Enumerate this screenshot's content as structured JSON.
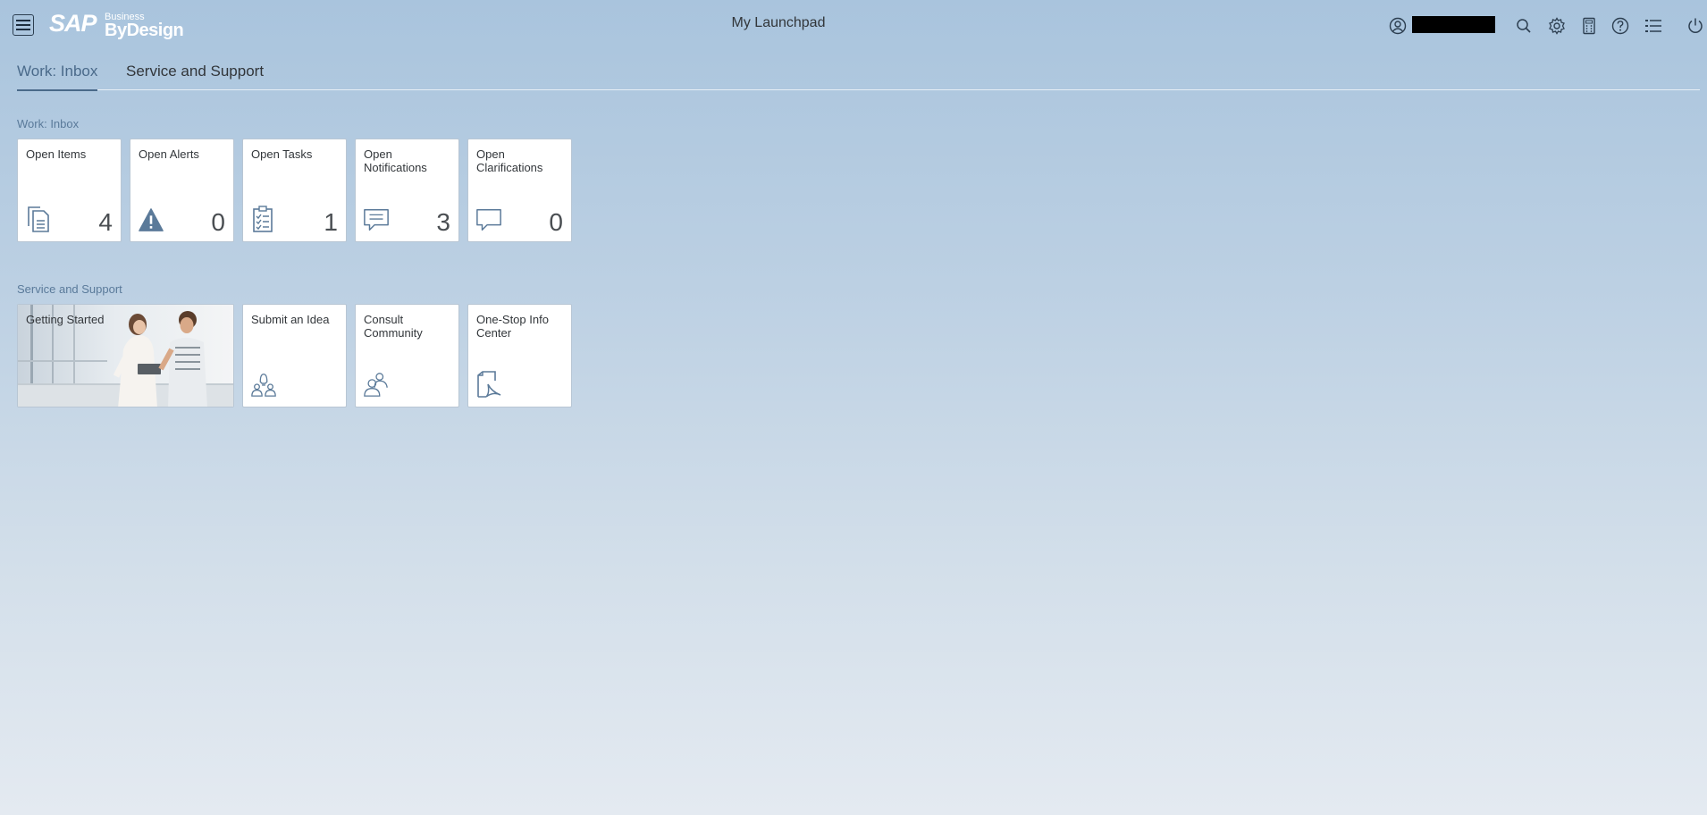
{
  "header": {
    "app_title": "My Launchpad",
    "logo": {
      "sap": "SAP",
      "business": "Business",
      "bydesign": "ByDesign"
    },
    "icons": [
      "menu-icon",
      "user-icon",
      "search-icon",
      "gear-icon",
      "calculator-icon",
      "help-icon",
      "list-icon",
      "power-icon"
    ]
  },
  "tabs": [
    {
      "label": "Work: Inbox",
      "active": true
    },
    {
      "label": "Service and Support",
      "active": false
    }
  ],
  "groups": {
    "work_inbox": {
      "title": "Work: Inbox",
      "tiles": [
        {
          "title": "Open Items",
          "count": "4",
          "icon": "documents-icon"
        },
        {
          "title": "Open Alerts",
          "count": "0",
          "icon": "alert-icon"
        },
        {
          "title": "Open Tasks",
          "count": "1",
          "icon": "task-list-icon"
        },
        {
          "title": "Open Notifications",
          "count": "3",
          "icon": "message-icon"
        },
        {
          "title": "Open Clarifications",
          "count": "0",
          "icon": "comment-icon"
        }
      ]
    },
    "service_support": {
      "title": "Service and Support",
      "tiles": [
        {
          "title": "Getting Started",
          "icon": "photo-people"
        },
        {
          "title": "Submit an Idea",
          "icon": "idea-people-icon"
        },
        {
          "title": "Consult Community",
          "icon": "community-icon"
        },
        {
          "title": "One-Stop Info Center",
          "icon": "pdf-document-icon"
        }
      ]
    }
  },
  "colors": {
    "accent": "#4a6a8a",
    "icon": "#5b7a99",
    "tile_border": "#b8c6d4"
  }
}
